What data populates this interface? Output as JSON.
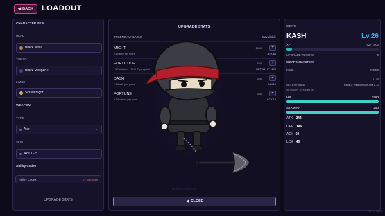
{
  "header": {
    "back_label": "BACK",
    "back_icon": "chevron-left-icon",
    "title": "LOADOUT"
  },
  "left": {
    "section_title": "CHARACTER SKIN",
    "head_label": "HEAD",
    "head_value": "Black Ninja",
    "torso_label": "TORSO",
    "torso_value": "Black Reaper 1",
    "limbs_label": "LIMBS",
    "limbs_value": "Skull Knight",
    "weapon_title": "WEAPON",
    "type_label": "TYPE",
    "type_value": "Axe",
    "skin_label": "SKIN",
    "skin_value": "Axe 1 - 5",
    "codex_title": "Ability Codex",
    "codex_field": "Ability Codex",
    "codex_badge": "27 unlocked",
    "upgrade_button": "UPGRADE STATS"
  },
  "center": {
    "title": "UPGRADE STATS",
    "tokens_label": "TOKENS AVAILABLE",
    "tokens_value": "0 available",
    "stats": [
      {
        "name": "MIGHT",
        "desc": "+3 Might per point",
        "level": "10/40",
        "effect": "ATK 64"
      },
      {
        "name": "FORTITUDE",
        "desc": "+1 Fortitude, +1% HP per point",
        "level": "5/40",
        "effect": "DEF 16  HP 1590"
      },
      {
        "name": "DASH",
        "desc": "+1 Dash per point",
        "level": "0/40",
        "effect": "AGI 10"
      },
      {
        "name": "FORTUNE",
        "desc": "+1 Fortune per point",
        "level": "0/40",
        "effect": "LCK 16"
      }
    ],
    "plus_label": "+",
    "close_label": "CLOSE",
    "watermark": "MOBILE PREVIEW"
  },
  "right": {
    "title": "STATS",
    "name": "KASH",
    "level": "Lv.26",
    "xp_label": "XP",
    "xp_value": "62 / 1000",
    "xp_fraction": 0.062,
    "tokens_label": "UPGRADE TOKENS",
    "tokens_value": "0",
    "mastery_title": "WEAPON MASTERY",
    "rank_label": "RANK",
    "rank_value": "Rank 6",
    "mastery_progress": "0 / 10",
    "next_reward_label": "NEXT REWARD",
    "next_reward_value": "Rank 2: Weapon Skin Axe 2 - 1",
    "mastery_note": "No mastery XP earned yet.",
    "hp_label": "HP",
    "hp_value": "1590",
    "hp_fraction": 1.0,
    "stamina_label": "STAMINA",
    "stamina_value": "250",
    "stamina_fraction": 1.0,
    "atk_label": "ATK",
    "atk": "244",
    "def_label": "DEF",
    "def": "146",
    "agi_label": "AGI",
    "agi": "50",
    "lck_label": "LCK",
    "lck": "40"
  },
  "version": "v0.1.5 alpha",
  "colors": {
    "accent_pink": "#c84b8a",
    "level_blue": "#3fa7e6",
    "bar_teal": "#3fd1c8",
    "xp_teal": "#27b5b0"
  }
}
